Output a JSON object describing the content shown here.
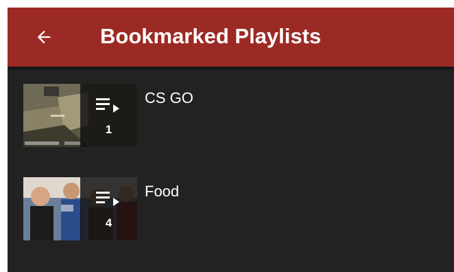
{
  "app_bar": {
    "title": "Bookmarked Playlists",
    "back_icon": "arrow-left-icon",
    "color": "#9c2a24"
  },
  "background_color": "#222222",
  "playlists": [
    {
      "title": "CS GO",
      "video_count": "1",
      "thumbnail": "game-screenshot-thumbnail",
      "icon": "playlist-play-icon"
    },
    {
      "title": "Food",
      "video_count": "4",
      "thumbnail": "people-crowd-thumbnail",
      "icon": "playlist-play-icon"
    }
  ]
}
